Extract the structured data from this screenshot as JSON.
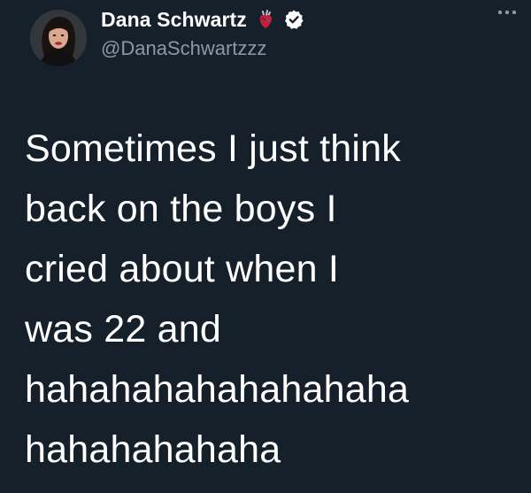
{
  "tweet": {
    "author": {
      "display_name": "Dana Schwartz",
      "handle": "@DanaSchwartzzz",
      "name_emoji": "anatomical-heart-icon",
      "verified_icon": "verified-badge-icon",
      "avatar": "profile-photo"
    },
    "menu_icon": "more-options-icon",
    "text_lines": [
      "Sometimes I just think",
      "back on the boys I",
      "cried about when I",
      "was 22 and",
      "hahahahahahahahaha",
      "hahahahahaha"
    ]
  },
  "colors": {
    "background": "#15202b",
    "text_primary": "#ffffff",
    "text_secondary": "#8b98a5",
    "verified_badge": "#ffffff"
  }
}
